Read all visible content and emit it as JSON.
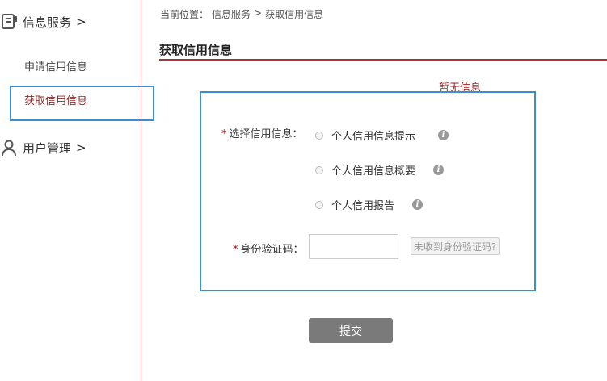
{
  "sidebar": {
    "info_service": {
      "label": "信息服务",
      "arrow": ">",
      "icon": "document-service-icon"
    },
    "items": [
      {
        "label": "申请信用信息",
        "active": false
      },
      {
        "label": "获取信用信息",
        "active": true
      }
    ],
    "user_mgmt": {
      "label": "用户管理",
      "arrow": ">",
      "icon": "user-icon"
    }
  },
  "breadcrumb": {
    "prefix": "当前位置：",
    "level1": "信息服务",
    "sep": ">",
    "level2": "获取信用信息"
  },
  "page": {
    "title": "获取信用信息",
    "no_info": "暂无信息"
  },
  "form": {
    "select_label": "选择信用信息：",
    "required_mark": "*",
    "options": [
      {
        "label": "个人信用信息提示"
      },
      {
        "label": "个人信用信息概要"
      },
      {
        "label": "个人信用报告"
      }
    ],
    "info_glyph": "i",
    "id_code_label": "身份验证码：",
    "id_code_value": "",
    "resend_label": "未收到身份验证码?",
    "submit_label": "提交"
  },
  "colors": {
    "accent_red": "#8b2a2a",
    "highlight_blue": "#3b8fd1",
    "button_gray": "#7a7a7a"
  }
}
